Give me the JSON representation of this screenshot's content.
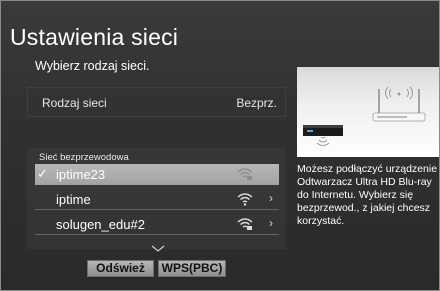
{
  "screen": {
    "title": "Ustawienia sieci",
    "subtitle": "Wybierz rodzaj sieci."
  },
  "network_type": {
    "label": "Rodzaj sieci",
    "value": "Bezprz."
  },
  "wireless_list": {
    "header": "Sieć bezprzewodowa",
    "items": [
      {
        "name": "iptime23",
        "selected": true,
        "icon": "wifi-lock-icon"
      },
      {
        "name": "iptime",
        "selected": false,
        "icon": "wifi-icon"
      },
      {
        "name": "solugen_edu#2",
        "selected": false,
        "icon": "wifi-lock-icon"
      }
    ]
  },
  "buttons": {
    "refresh": "Odśwież",
    "wps": "WPS(PBC)"
  },
  "info": {
    "lines": [
      "Możesz podłączyć urządzenie",
      "Odtwarzacz Ultra HD Blu-ray",
      "do Internetu. Wybierz się",
      "bezprzewod., z jakiej chcesz",
      "korzystać."
    ]
  },
  "colors": {
    "background": "#303030",
    "selected": "#a8a8a8",
    "button": "#a0a0a0",
    "text": "#ffffff"
  }
}
